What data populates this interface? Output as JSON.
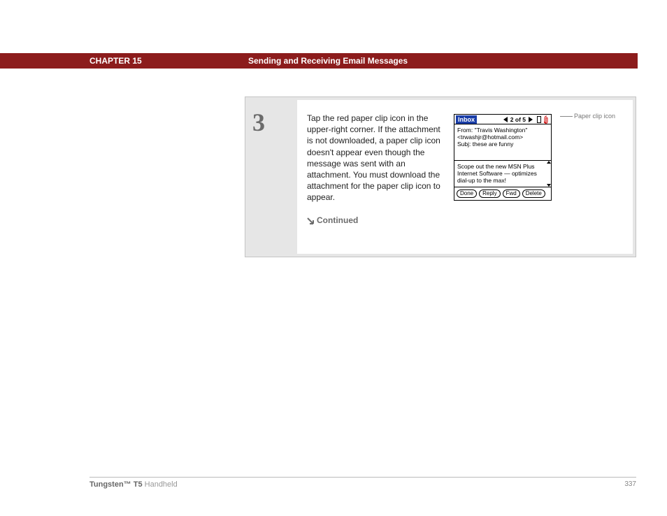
{
  "header": {
    "chapter": "CHAPTER 15",
    "title": "Sending and Receiving Email Messages"
  },
  "step": {
    "number": "3",
    "instruction": "Tap the red paper clip icon in the upper-right corner. If the attachment is not downloaded, a paper clip icon doesn't appear even though the message was sent with an attachment. You must download the attachment for the paper clip icon to appear.",
    "continued": "Continued"
  },
  "callout": {
    "label": "Paper clip icon"
  },
  "device": {
    "inbox_label": "Inbox",
    "counter": "2 of 5",
    "from_label": "From:",
    "from_name": "\"Travis Washington\"",
    "from_addr": "<trwashjr@hotmail.com>",
    "subj_label": "Subj:",
    "subj_text": "these are funny",
    "body_text": "Scope out the new MSN Plus Internet Software — optimizes dial-up to the max!",
    "buttons": {
      "done": "Done",
      "reply": "Reply",
      "fwd": "Fwd",
      "delete": "Delete"
    }
  },
  "footer": {
    "product_bold": "Tungsten™ T5",
    "product_light": " Handheld",
    "page": "337"
  }
}
